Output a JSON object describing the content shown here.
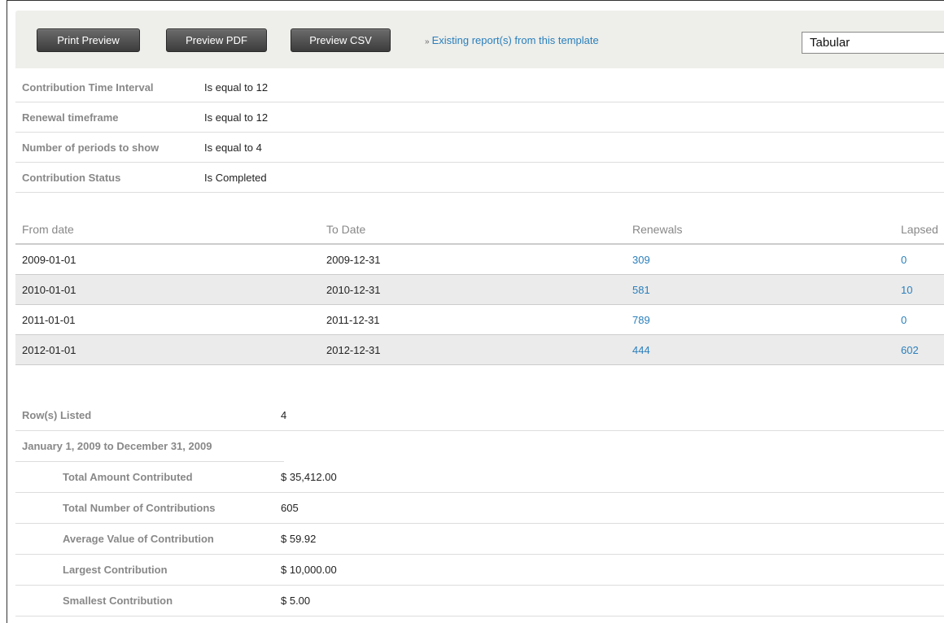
{
  "toolbar": {
    "print_preview": "Print Preview",
    "preview_pdf": "Preview PDF",
    "preview_csv": "Preview CSV",
    "existing_reports_prefix": "»",
    "existing_reports": "Existing report(s) from this template",
    "view_mode": "Tabular"
  },
  "criteria": [
    {
      "label": "Contribution Time Interval",
      "value": "Is equal to 12"
    },
    {
      "label": "Renewal timeframe",
      "value": "Is equal to 12"
    },
    {
      "label": "Number of periods to show",
      "value": "Is equal to 4"
    },
    {
      "label": "Contribution Status",
      "value": "Is Completed"
    }
  ],
  "results": {
    "columns": [
      "From date",
      "To Date",
      "Renewals",
      "Lapsed"
    ],
    "rows": [
      {
        "from": "2009-01-01",
        "to": "2009-12-31",
        "renewals": "309",
        "lapsed": "0"
      },
      {
        "from": "2010-01-01",
        "to": "2010-12-31",
        "renewals": "581",
        "lapsed": "10"
      },
      {
        "from": "2011-01-01",
        "to": "2011-12-31",
        "renewals": "789",
        "lapsed": "0"
      },
      {
        "from": "2012-01-01",
        "to": "2012-12-31",
        "renewals": "444",
        "lapsed": "602"
      }
    ]
  },
  "summary": {
    "rows_listed_label": "Row(s) Listed",
    "rows_listed_value": "4",
    "period_label": "January 1, 2009 to December 31, 2009",
    "stats": [
      {
        "label": "Total Amount Contributed",
        "value": "$ 35,412.00"
      },
      {
        "label": "Total Number of Contributions",
        "value": "605"
      },
      {
        "label": "Average Value of Contribution",
        "value": "$ 59.92"
      },
      {
        "label": "Largest Contribution",
        "value": "$ 10,000.00"
      },
      {
        "label": "Smallest Contribution",
        "value": "$ 5.00"
      }
    ]
  }
}
